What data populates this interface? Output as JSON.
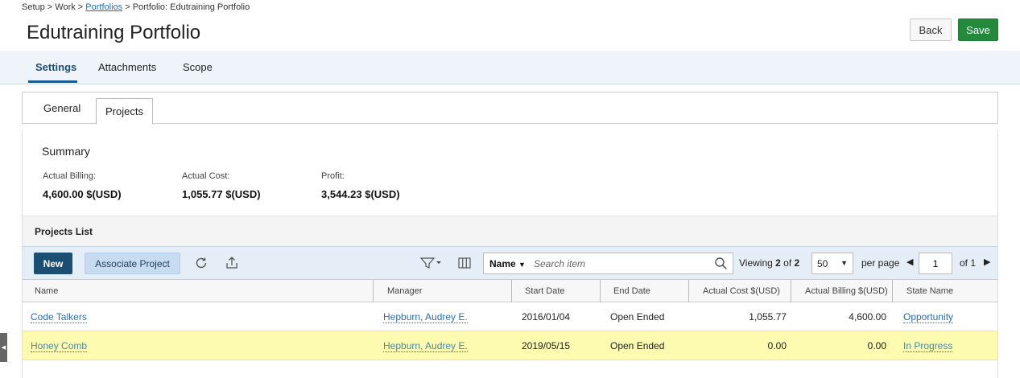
{
  "breadcrumb": {
    "part1": "Setup > Work > ",
    "link": "Portfolios",
    "part2": " > Portfolio: Edutraining Portfolio"
  },
  "title": "Edutraining Portfolio",
  "actions": {
    "back": "Back",
    "save": "Save"
  },
  "main_tabs": [
    {
      "label": "Settings",
      "active": true
    },
    {
      "label": "Attachments",
      "active": false
    },
    {
      "label": "Scope",
      "active": false
    }
  ],
  "sub_tabs": [
    {
      "label": "General",
      "active": false
    },
    {
      "label": "Projects",
      "active": true
    }
  ],
  "summary": {
    "title": "Summary",
    "billing_label": "Actual Billing:",
    "billing_value": "4,600.00 $(USD)",
    "cost_label": "Actual Cost:",
    "cost_value": "1,055.77 $(USD)",
    "profit_label": "Profit:",
    "profit_value": "3,544.23 $(USD)"
  },
  "projects_list": {
    "title": "Projects List",
    "new_label": "New",
    "associate_label": "Associate Project",
    "search_scope": "Name",
    "search_placeholder": "Search item",
    "viewing_prefix": "Viewing ",
    "viewing_count": "2",
    "viewing_of": " of ",
    "viewing_total": "2",
    "per_page_value": "50",
    "per_page_label": "per page",
    "page_value": "1",
    "page_of": "of 1"
  },
  "columns": [
    "Name",
    "Manager",
    "Start Date",
    "End Date",
    "Actual Cost $(USD)",
    "Actual Billing $(USD)",
    "State Name"
  ],
  "rows": [
    {
      "name": "Code Talkers",
      "manager": "Hepburn, Audrey E.",
      "start": "2016/01/04",
      "end": "Open Ended",
      "cost": "1,055.77",
      "billing": "4,600.00",
      "state": "Opportunity"
    },
    {
      "name": "Honey Comb",
      "manager": "Hepburn, Audrey E.",
      "start": "2019/05/15",
      "end": "Open Ended",
      "cost": "0.00",
      "billing": "0.00",
      "state": "In Progress"
    }
  ],
  "colors": {
    "save": "#238a3c",
    "new": "#1b4f72",
    "link": "#2a6db5",
    "highlight": "#fcfbb0"
  }
}
